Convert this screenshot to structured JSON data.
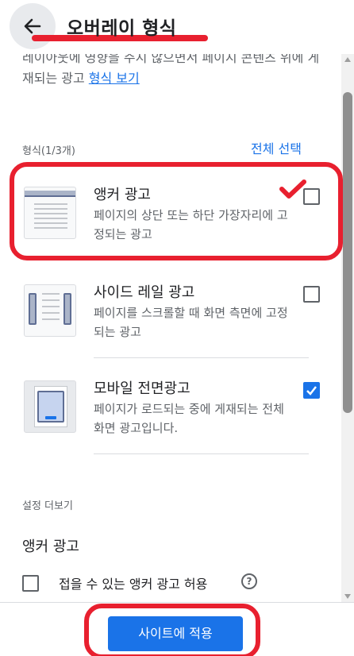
{
  "header": {
    "title": "오버레이 형식",
    "back_icon": "arrow-left-icon"
  },
  "intro": {
    "text": "레이아웃에 영향을 주지 않으면서 페이지 콘텐츠 위에 게재되는 광고",
    "link": "형식 보기"
  },
  "formats": {
    "label": "형식(1/3개)",
    "select_all": "전체 선택",
    "items": [
      {
        "name": "앵커 광고",
        "desc": "페이지의 상단 또는 하단 가장자리에 고정되는 광고",
        "checked": false,
        "icon": "anchor-ad-thumbnail"
      },
      {
        "name": "사이드 레일 광고",
        "desc": "페이지를 스크롤할 때 화면 측면에 고정되는 광고",
        "checked": false,
        "icon": "side-rail-ad-thumbnail"
      },
      {
        "name": "모바일 전면광고",
        "desc": "페이지가 로드되는 중에 게재되는 전체 화면 광고입니다.",
        "checked": true,
        "icon": "mobile-interstitial-thumbnail"
      }
    ]
  },
  "more_settings": {
    "label": "설정 더보기",
    "section_title": "앵커 광고",
    "option_label": "접을 수 있는 앵커 광고 허용",
    "option_checked": false,
    "help_icon": "help-icon",
    "help_glyph": "?"
  },
  "footer": {
    "apply_label": "사이트에 적용"
  },
  "colors": {
    "accent": "#1a73e8",
    "annotation": "#e8202f",
    "text_primary": "#202124",
    "text_secondary": "#5f6368"
  }
}
